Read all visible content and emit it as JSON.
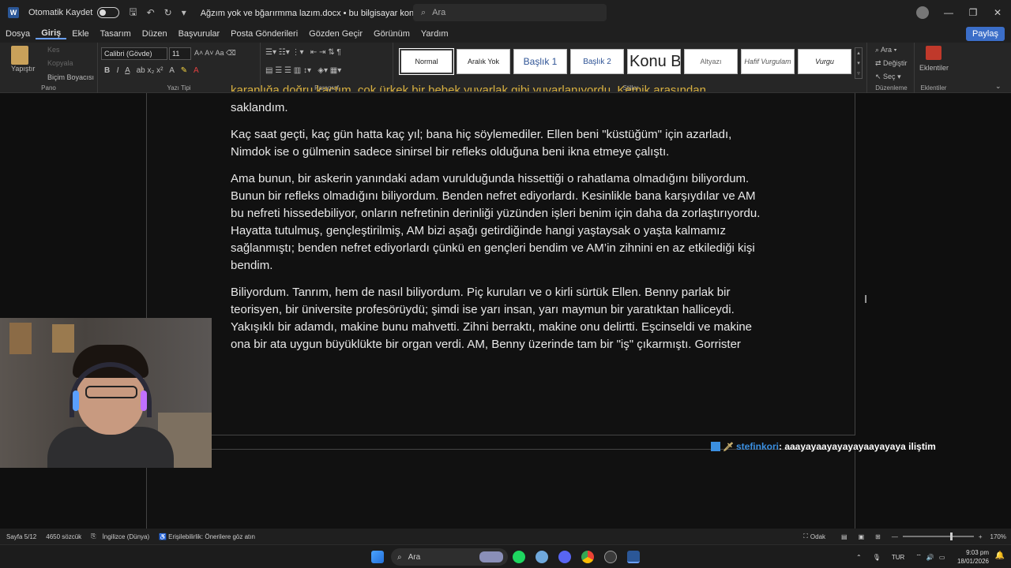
{
  "titlebar": {
    "autosave_label": "Otomatik Kaydet",
    "doc_title": "Ağzım yok  ve bğarırmma lazım.docx  •  bu bilgisayar konumuna kaydedildi ⌄",
    "search_placeholder": "Ara"
  },
  "menu": {
    "items": [
      "Dosya",
      "Giriş",
      "Ekle",
      "Tasarım",
      "Düzen",
      "Başvurular",
      "Posta Gönderileri",
      "Gözden Geçir",
      "Görünüm",
      "Yardım"
    ],
    "share": "Paylaş"
  },
  "ribbon": {
    "clipboard": {
      "paste": "Yapıştır",
      "cut": "Kes",
      "copy": "Kopyala",
      "format_painter": "Biçim Boyacısı",
      "label": "Pano"
    },
    "font": {
      "name": "Calibri (Gövde)",
      "size": "11",
      "label": "Yazı Tipi"
    },
    "paragraph": {
      "label": "Paragraf"
    },
    "styles": {
      "items": [
        "Normal",
        "Aralık Yok",
        "Başlık 1",
        "Başlık 2",
        "Konu B",
        "Altyazı",
        "Hafif Vurgulam",
        "Vurgu"
      ],
      "label": "Stiller"
    },
    "editing": {
      "find": "Ara",
      "replace": "Değiştir",
      "select": "Seç",
      "label": "Düzenleme"
    },
    "addins": {
      "button": "Eklentiler",
      "label": "Eklentiler"
    }
  },
  "document": {
    "cut_line": "karanlığa doğru kaçtım, çok ürkek bir bebek yuvarlak gibi yuvarlanıyordu. Kemik arasından uzaklaştım ve",
    "p0": "saklandım.",
    "p1": "Kaç saat geçti, kaç gün hatta kaç yıl; bana hiç söylemediler. Ellen beni \"küstüğüm\" için azarladı, Nimdok ise o gülmenin sadece sinirsel bir refleks olduğuna beni ikna etmeye çalıştı.",
    "p2": "Ama bunun, bir askerin yanındaki adam vurulduğunda hissettiği o rahatlama olmadığını biliyordum. Bunun bir refleks olmadığını biliyordum. Benden nefret ediyorlardı. Kesinlikle bana karşıydılar ve AM bu nefreti hissedebiliyor, onların nefretinin derinliği yüzünden işleri benim için daha da zorlaştırıyordu. Hayatta tutulmuş, gençleştirilmiş, AM bizi aşağı getirdiğinde hangi yaştaysak o yaşta kalmamız sağlanmıştı; benden nefret ediyorlardı çünkü en gençleri bendim ve AM’in zihnini en az etkilediği kişi bendim.",
    "p3": "Biliyordum. Tanrım, hem de nasıl biliyordum. Piç kuruları ve o kirli sürtük Ellen. Benny parlak bir teorisyen, bir üniversite profesörüydü; şimdi ise yarı insan, yarı maymun bir yaratıktan halliceydi. Yakışıklı bir adamdı, makine bunu mahvetti. Zihni berraktı, makine onu delirtti. Eşcinseldi ve makine ona bir ata uygun büyüklükte bir organ verdi. AM, Benny üzerinde tam bir \"iş\" çıkarmıştı. Gorrister"
  },
  "chat": {
    "user": "stefinkori",
    "message": ": aaayayaayayayayaayayaya iliştim"
  },
  "statusbar": {
    "page": "Sayfa 5/12",
    "words": "4650 sözcük",
    "language": "İngilizce (Dünya)",
    "accessibility": "Erişilebilirlik: Önerilere göz atın",
    "focus": "Odak",
    "zoom": "170%"
  },
  "taskbar": {
    "search": "Ara",
    "lang": "TUR",
    "time": "9:03 pm",
    "date": "18/01/2026"
  }
}
